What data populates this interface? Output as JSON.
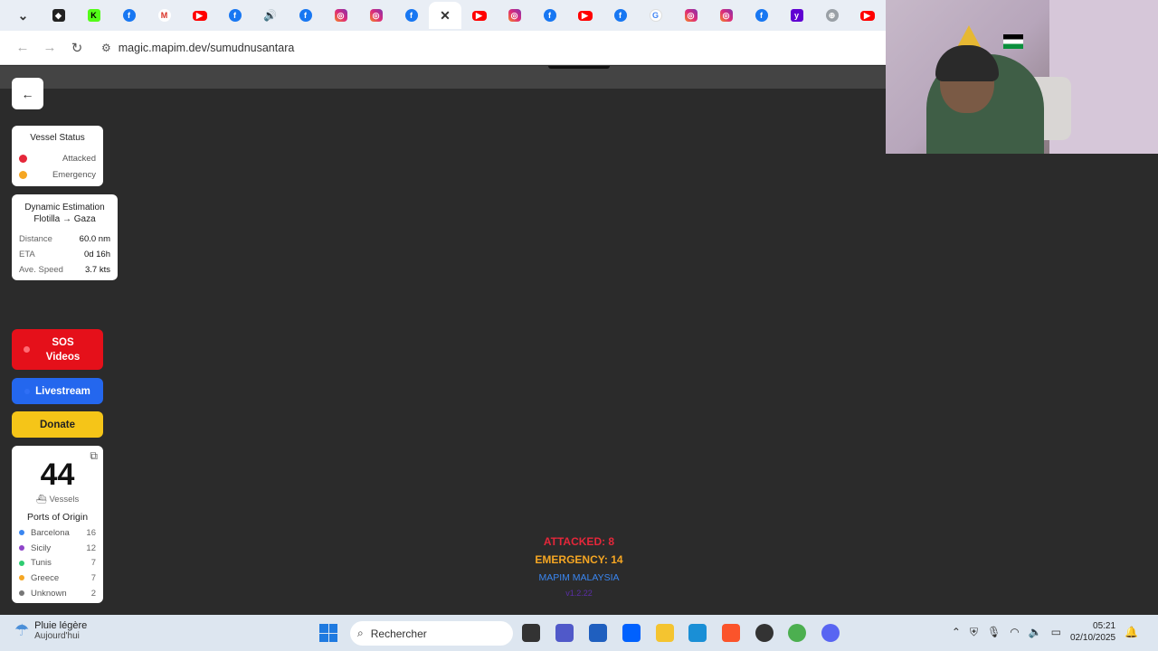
{
  "browser": {
    "tabs": [
      {
        "icon": "chevron-down-icon",
        "cls": "x",
        "glyph": "⌄"
      },
      {
        "icon": "github-icon",
        "cls": "gh",
        "glyph": "◆"
      },
      {
        "icon": "kick-icon",
        "cls": "k",
        "glyph": "K"
      },
      {
        "icon": "facebook-icon",
        "cls": "fb",
        "glyph": "f"
      },
      {
        "icon": "gmail-icon",
        "cls": "gm",
        "glyph": "M"
      },
      {
        "icon": "youtube-icon",
        "cls": "yt",
        "glyph": "▶"
      },
      {
        "icon": "facebook-icon",
        "cls": "fb",
        "glyph": "f"
      },
      {
        "icon": "audio-icon",
        "cls": "snd",
        "glyph": "🔊"
      },
      {
        "icon": "facebook-icon",
        "cls": "fb",
        "glyph": "f"
      },
      {
        "icon": "instagram-icon",
        "cls": "ig",
        "glyph": "◎"
      },
      {
        "icon": "instagram-icon",
        "cls": "ig",
        "glyph": "◎"
      },
      {
        "icon": "facebook-icon",
        "cls": "fb",
        "glyph": "f"
      },
      {
        "icon": "close-icon",
        "cls": "x",
        "glyph": "✕",
        "active": true
      },
      {
        "icon": "youtube-icon",
        "cls": "yt",
        "glyph": "▶"
      },
      {
        "icon": "instagram-icon",
        "cls": "ig",
        "glyph": "◎"
      },
      {
        "icon": "facebook-icon",
        "cls": "fb",
        "glyph": "f"
      },
      {
        "icon": "youtube-icon",
        "cls": "yt",
        "glyph": "▶"
      },
      {
        "icon": "facebook-icon",
        "cls": "fb",
        "glyph": "f"
      },
      {
        "icon": "google-icon",
        "cls": "g",
        "glyph": "G"
      },
      {
        "icon": "instagram-icon",
        "cls": "ig",
        "glyph": "◎"
      },
      {
        "icon": "instagram-icon",
        "cls": "ig",
        "glyph": "◎"
      },
      {
        "icon": "facebook-icon",
        "cls": "fb",
        "glyph": "f"
      },
      {
        "icon": "yahoo-icon",
        "cls": "yh",
        "glyph": "y"
      },
      {
        "icon": "globe-icon",
        "cls": "globe",
        "glyph": "⊕"
      },
      {
        "icon": "youtube-icon",
        "cls": "yt",
        "glyph": "▶"
      }
    ],
    "url": "magic.mapim.dev/sumudnusantara"
  },
  "legend": {
    "title": "Vessel Status",
    "items": [
      {
        "label": "Attacked",
        "color": "#e5273a"
      },
      {
        "label": "Emergency",
        "color": "#f5a623"
      }
    ]
  },
  "estimation": {
    "title_line1": "Dynamic Estimation",
    "title_line2": "Flotilla → Gaza",
    "rows": [
      {
        "key": "Distance",
        "value": "60.0 nm"
      },
      {
        "key": "ETA",
        "value": "0d 16h"
      },
      {
        "key": "Ave. Speed",
        "value": "3.7 kts"
      }
    ]
  },
  "buttons": {
    "sos_line1": "SOS",
    "sos_line2": "Videos",
    "livestream": "Livestream",
    "donate": "Donate"
  },
  "vessels": {
    "count": "44",
    "label": "Vessels",
    "ports_title": "Ports of Origin",
    "ports": [
      {
        "name": "Barcelona",
        "count": "16",
        "color": "#3a86f0"
      },
      {
        "name": "Sicily",
        "count": "12",
        "color": "#8e44c9"
      },
      {
        "name": "Tunis",
        "count": "7",
        "color": "#2ecc71"
      },
      {
        "name": "Greece",
        "count": "7",
        "color": "#f5a623"
      },
      {
        "name": "Unknown",
        "count": "2",
        "color": "#777777"
      }
    ]
  },
  "summary": {
    "attacked": "ATTACKED: 8",
    "emergency": "EMERGENCY: 14",
    "org": "MAPIM MALAYSIA",
    "version": "v1.2.22"
  },
  "taskbar": {
    "weather_line1": "Pluie légère",
    "weather_line2": "Aujourd'hui",
    "search_placeholder": "Rechercher",
    "time": "05:21",
    "date": "02/10/2025"
  }
}
